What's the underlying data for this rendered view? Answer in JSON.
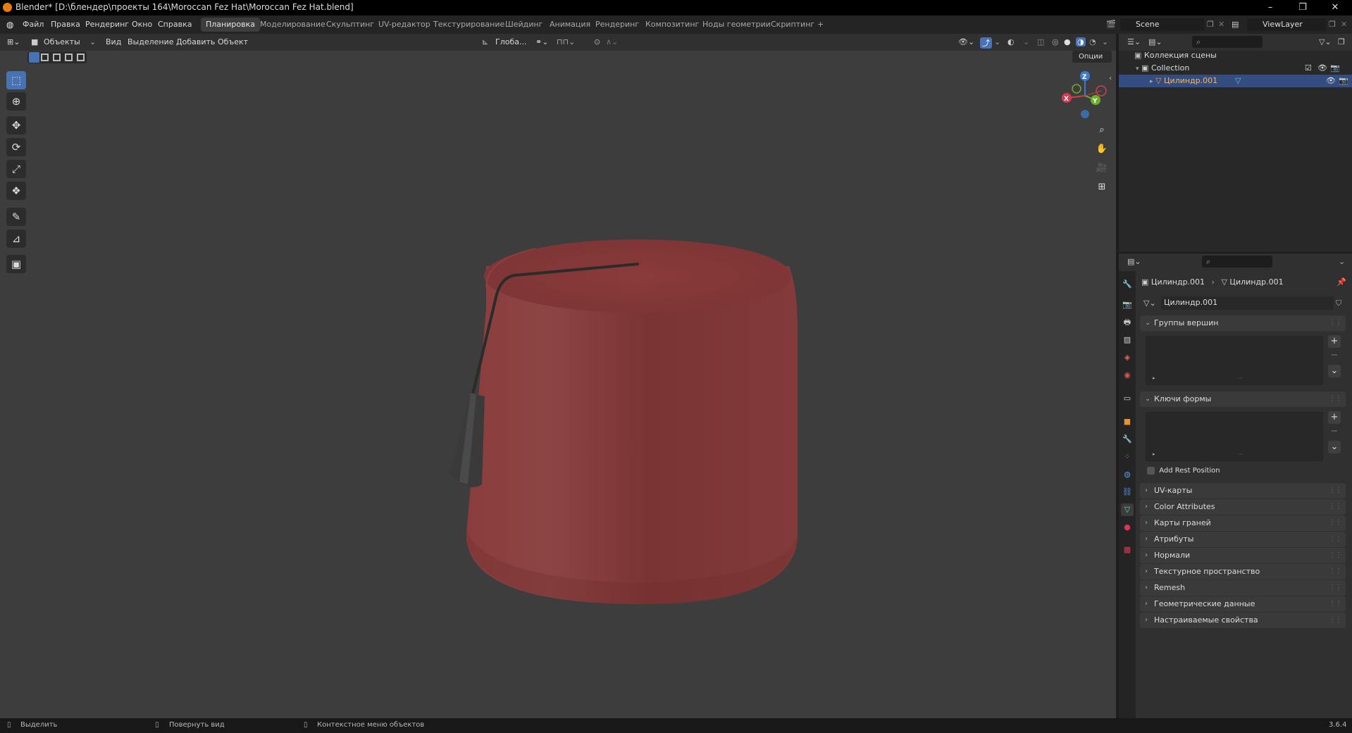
{
  "window": {
    "title": "Blender* [D:\\блендер\\проекты 164\\Moroccan Fez Hat\\Moroccan Fez Hat.blend]",
    "minimize": "–",
    "maximize": "❐",
    "close": "✕"
  },
  "menus": [
    "Файл",
    "Правка",
    "Рендеринг",
    "Окно",
    "Справка"
  ],
  "workspaces": [
    "Планировка",
    "Моделирование",
    "Скульптинг",
    "UV-редактор",
    "Текстурирование",
    "Шейдинг",
    "Анимация",
    "Рендеринг",
    "Композитинг",
    "Ноды геометрии",
    "Скриптинг"
  ],
  "active_workspace": "Планировка",
  "add_workspace": "+",
  "scene": {
    "name": "Scene",
    "viewlayer": "ViewLayer"
  },
  "viewport": {
    "mode": "Объекты",
    "menus": [
      "Вид",
      "Выделение",
      "Добавить",
      "Объект"
    ],
    "transform_orientation": "Глоба...",
    "options_label": "Опции",
    "gizmo_axes": {
      "x": "X",
      "y": "Y",
      "z": "Z"
    },
    "model_color": "#8a3a3a"
  },
  "tools": [
    {
      "name": "select-box",
      "glyph": "⬚"
    },
    {
      "name": "cursor",
      "glyph": "⊕"
    },
    {
      "name": "move",
      "glyph": "✥"
    },
    {
      "name": "rotate",
      "glyph": "⟳"
    },
    {
      "name": "scale",
      "glyph": "⤢"
    },
    {
      "name": "transform",
      "glyph": "❖"
    },
    {
      "name": "annotate",
      "glyph": "✎"
    },
    {
      "name": "measure",
      "glyph": "📐"
    },
    {
      "name": "add-cube",
      "glyph": "▣"
    }
  ],
  "outliner": {
    "root": "Коллекция сцены",
    "collection": "Collection",
    "object": "Цилиндр.001"
  },
  "properties": {
    "breadcrumb_object": "Цилиндр.001",
    "breadcrumb_mesh": "Цилиндр.001",
    "mesh_name": "Цилиндр.001",
    "vertex_groups": "Группы вершин",
    "shape_keys": "Ключи формы",
    "add_rest_position": "Add Rest Position",
    "panels": [
      "UV-карты",
      "Color Attributes",
      "Карты граней",
      "Атрибуты",
      "Нормали",
      "Текстурное пространство",
      "Remesh",
      "Геометрические данные",
      "Настраиваемые свойства"
    ]
  },
  "status": {
    "select": "Выделить",
    "rotate_view": "Повернуть вид",
    "context_menu": "Контекстное меню объектов",
    "version": "3.6.4"
  }
}
